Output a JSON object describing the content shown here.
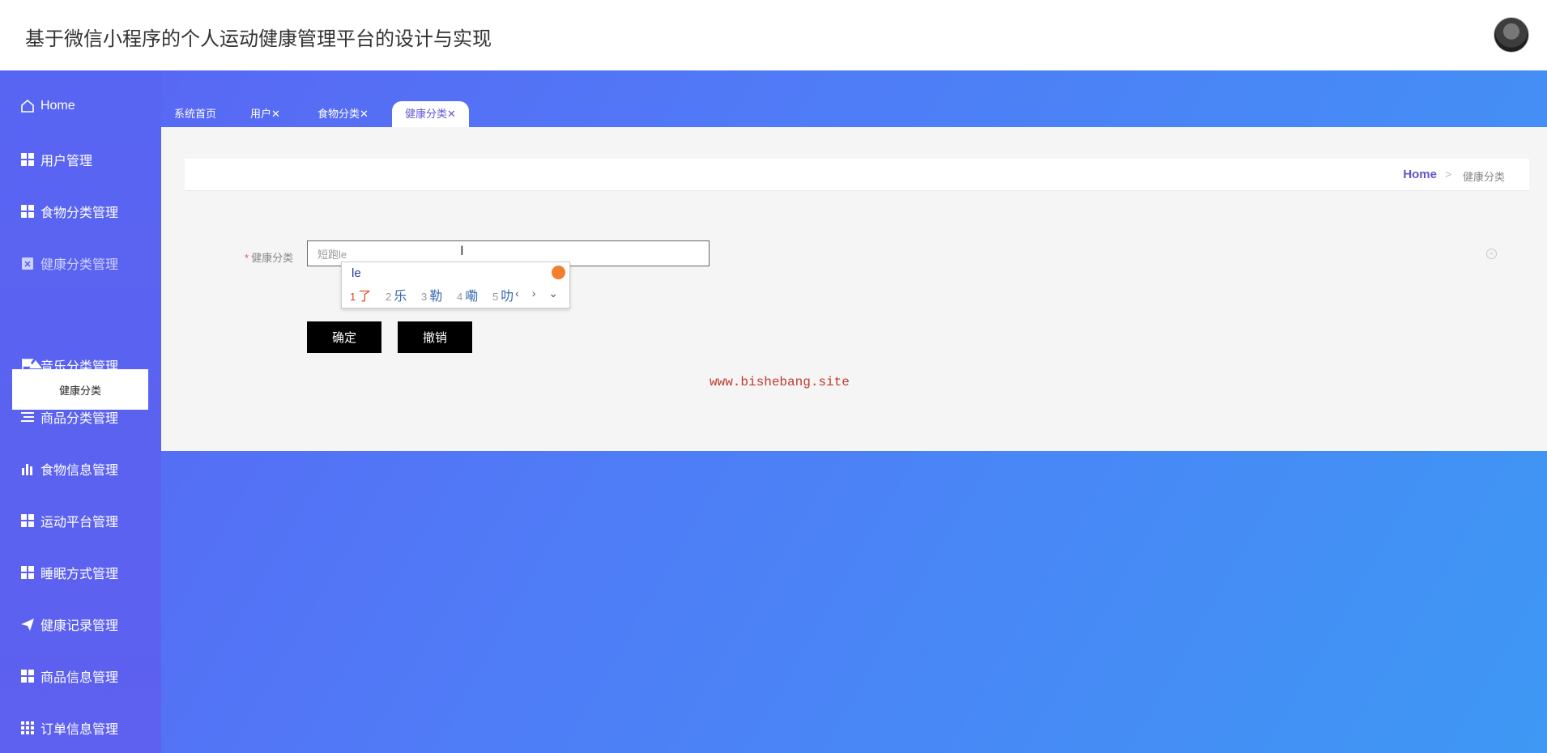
{
  "header": {
    "title": "基于微信小程序的个人运动健康管理平台的设计与实现",
    "avatar_icon": "user-avatar"
  },
  "sidebar": {
    "home": {
      "label": "Home",
      "icon": "home-icon"
    },
    "items": [
      {
        "label": "用户管理",
        "icon": "grid-icon"
      },
      {
        "label": "食物分类管理",
        "icon": "grid-icon"
      },
      {
        "label": "健康分类管理",
        "icon": "clipboard-icon"
      },
      {
        "label": "音乐分类管理",
        "icon": "flag-icon"
      },
      {
        "label": "商品分类管理",
        "icon": "list-icon"
      },
      {
        "label": "食物信息管理",
        "icon": "bar-chart-icon"
      },
      {
        "label": "运动平台管理",
        "icon": "grid-icon"
      },
      {
        "label": "睡眠方式管理",
        "icon": "grid-icon"
      },
      {
        "label": "健康记录管理",
        "icon": "paper-plane-icon"
      },
      {
        "label": "商品信息管理",
        "icon": "grid-icon"
      },
      {
        "label": "订单信息管理",
        "icon": "grid9-icon"
      }
    ],
    "submenu": {
      "label": "健康分类"
    }
  },
  "tabs": [
    {
      "label": "系统首页",
      "closable": false
    },
    {
      "label": "用户",
      "closable": true
    },
    {
      "label": "食物分类",
      "closable": true
    },
    {
      "label": "健康分类",
      "closable": true,
      "active": true
    }
  ],
  "tab_close_glyph": "✕",
  "breadcrumb": {
    "home": "Home",
    "separator": ">",
    "current": "健康分类"
  },
  "form": {
    "required_mark": "*",
    "label": "健康分类",
    "value": "短跑le",
    "submit_label": "确定",
    "cancel_label": "撤销"
  },
  "ime": {
    "composition": "le",
    "candidates": [
      {
        "n": "1",
        "text": "了"
      },
      {
        "n": "2",
        "text": "乐"
      },
      {
        "n": "3",
        "text": "勒"
      },
      {
        "n": "4",
        "text": "嘞"
      },
      {
        "n": "5",
        "text": "叻"
      }
    ],
    "nav": "‹ › ⌄"
  },
  "watermark": "www.bishebang.site",
  "colors": {
    "accent": "#5e58c9",
    "sidebar": "#5865f2",
    "button": "#000000",
    "required": "#ee5555"
  }
}
